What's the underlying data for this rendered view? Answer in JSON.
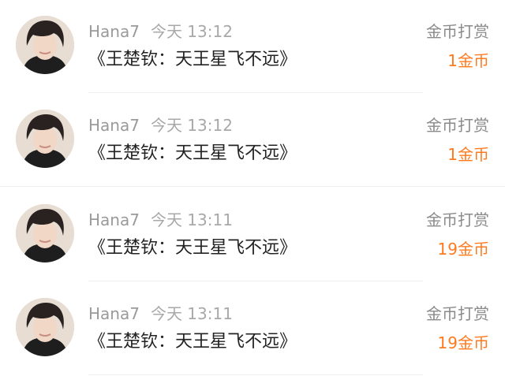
{
  "records": [
    {
      "user": "Hana7",
      "time": "今天 13:12",
      "gift": "《王楚钦：天王星飞不远》",
      "type": "金币打赏",
      "amount": "1金币"
    },
    {
      "user": "Hana7",
      "time": "今天 13:12",
      "gift": "《王楚钦：天王星飞不远》",
      "type": "金币打赏",
      "amount": "1金币"
    },
    {
      "user": "Hana7",
      "time": "今天 13:11",
      "gift": "《王楚钦：天王星飞不远》",
      "type": "金币打赏",
      "amount": "19金币"
    },
    {
      "user": "Hana7",
      "time": "今天 13:11",
      "gift": "《王楚钦：天王星飞不远》",
      "type": "金币打赏",
      "amount": "19金币"
    }
  ],
  "colors": {
    "accent": "#ff7a1e",
    "muted": "#9a9a9a",
    "text": "#222222"
  }
}
